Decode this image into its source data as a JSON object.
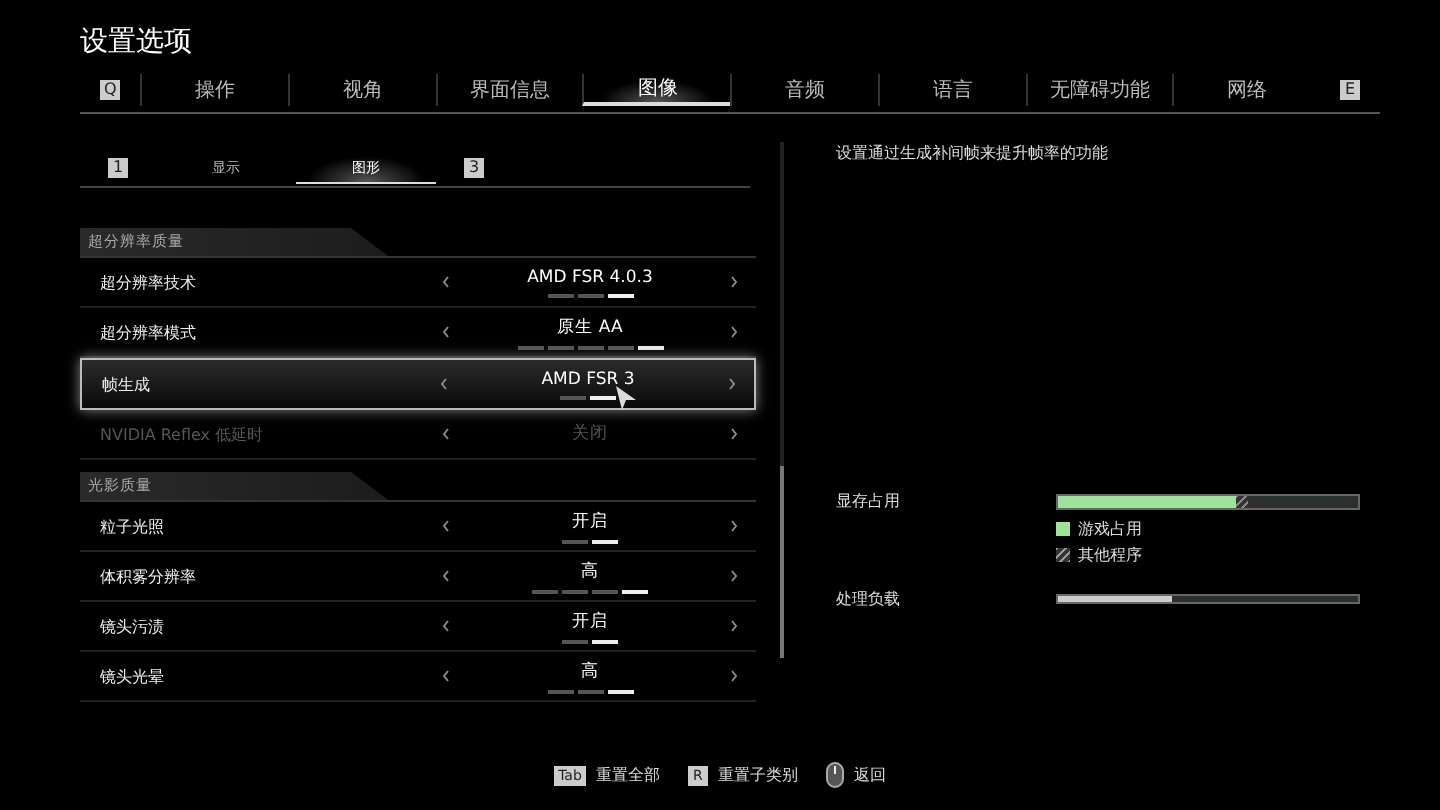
{
  "window": {
    "title": "设置选项"
  },
  "tabs": {
    "left_key": "Q",
    "right_key": "E",
    "items": [
      {
        "label": "操作",
        "selected": false
      },
      {
        "label": "视角",
        "selected": false
      },
      {
        "label": "界面信息",
        "selected": false
      },
      {
        "label": "图像",
        "selected": true
      },
      {
        "label": "音频",
        "selected": false
      },
      {
        "label": "语言",
        "selected": false
      },
      {
        "label": "无障碍功能",
        "selected": false
      },
      {
        "label": "网络",
        "selected": false
      }
    ]
  },
  "subtabs": {
    "left_key": "1",
    "right_key": "3",
    "items": [
      {
        "label": "显示",
        "selected": false
      },
      {
        "label": "图形",
        "selected": true
      }
    ]
  },
  "sections": [
    {
      "title": "超分辨率质量",
      "rows": [
        {
          "label": "超分辨率技术",
          "value": "AMD FSR 4.0.3",
          "selected": false,
          "disabled": false,
          "segments": [
            {
              "selected": false
            },
            {
              "selected": false
            },
            {
              "selected": true
            }
          ]
        },
        {
          "label": "超分辨率模式",
          "value": "原生 AA",
          "selected": false,
          "disabled": false,
          "segments": [
            {
              "selected": false
            },
            {
              "selected": false
            },
            {
              "selected": false
            },
            {
              "selected": false
            },
            {
              "selected": true
            }
          ]
        },
        {
          "label": "帧生成",
          "value": "AMD FSR 3",
          "selected": true,
          "disabled": false,
          "segments": [
            {
              "selected": false
            },
            {
              "selected": true
            }
          ]
        },
        {
          "label": "NVIDIA Reflex 低延时",
          "value": "关闭",
          "selected": false,
          "disabled": true,
          "segments": []
        }
      ]
    },
    {
      "title": "光影质量",
      "rows": [
        {
          "label": "粒子光照",
          "value": "开启",
          "selected": false,
          "disabled": false,
          "segments": [
            {
              "selected": false
            },
            {
              "selected": true
            }
          ]
        },
        {
          "label": "体积雾分辨率",
          "value": "高",
          "selected": false,
          "disabled": false,
          "segments": [
            {
              "selected": false
            },
            {
              "selected": false
            },
            {
              "selected": false
            },
            {
              "selected": true
            }
          ]
        },
        {
          "label": "镜头污渍",
          "value": "开启",
          "selected": false,
          "disabled": false,
          "segments": [
            {
              "selected": false
            },
            {
              "selected": true
            }
          ]
        },
        {
          "label": "镜头光晕",
          "value": "高",
          "selected": false,
          "disabled": false,
          "segments": [
            {
              "selected": false
            },
            {
              "selected": false
            },
            {
              "selected": true
            }
          ]
        }
      ]
    }
  ],
  "description": "设置通过生成补间帧来提升帧率的功能",
  "vram": {
    "label": "显存占用",
    "game": {
      "level": 0.59,
      "legend": "游戏占用"
    },
    "other": {
      "level": 0.04,
      "legend": "其他程序"
    }
  },
  "load": {
    "label": "处理负载",
    "level": 0.38
  },
  "footer": [
    {
      "key": "Tab",
      "label": "重置全部",
      "kind": "key"
    },
    {
      "key": "R",
      "label": "重置子类别",
      "kind": "key"
    },
    {
      "label": "返回",
      "kind": "mouse"
    }
  ]
}
